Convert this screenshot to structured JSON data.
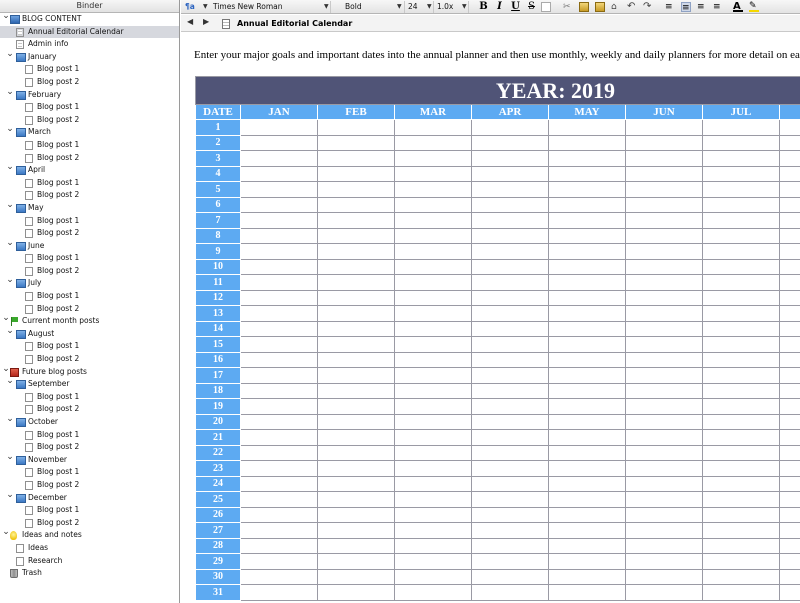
{
  "binder": {
    "title": "Binder",
    "items": [
      {
        "label": "BLOG CONTENT",
        "level": 0,
        "icon": "folder-root-icon",
        "chevron": true
      },
      {
        "label": "Annual Editorial Calendar",
        "level": 1,
        "icon": "document-text-icon",
        "selected": true
      },
      {
        "label": "Admin info",
        "level": 1,
        "icon": "document-text-icon"
      },
      {
        "label": "January",
        "level": 1,
        "icon": "folder-icon",
        "chevron": true
      },
      {
        "label": "Blog post 1",
        "level": 2,
        "icon": "document-icon"
      },
      {
        "label": "Blog post 2",
        "level": 2,
        "icon": "document-icon"
      },
      {
        "label": "February",
        "level": 1,
        "icon": "folder-icon",
        "chevron": true
      },
      {
        "label": "Blog post 1",
        "level": 2,
        "icon": "document-icon"
      },
      {
        "label": "Blog post 2",
        "level": 2,
        "icon": "document-icon"
      },
      {
        "label": "March",
        "level": 1,
        "icon": "folder-icon",
        "chevron": true
      },
      {
        "label": "Blog post 1",
        "level": 2,
        "icon": "document-icon"
      },
      {
        "label": "Blog post 2",
        "level": 2,
        "icon": "document-icon"
      },
      {
        "label": "April",
        "level": 1,
        "icon": "folder-icon",
        "chevron": true
      },
      {
        "label": "Blog post 1",
        "level": 2,
        "icon": "document-icon"
      },
      {
        "label": "Blog post 2",
        "level": 2,
        "icon": "document-icon"
      },
      {
        "label": "May",
        "level": 1,
        "icon": "folder-icon",
        "chevron": true
      },
      {
        "label": "Blog post 1",
        "level": 2,
        "icon": "document-icon"
      },
      {
        "label": "Blog post 2",
        "level": 2,
        "icon": "document-icon"
      },
      {
        "label": "June",
        "level": 1,
        "icon": "folder-icon",
        "chevron": true
      },
      {
        "label": "Blog post 1",
        "level": 2,
        "icon": "document-icon"
      },
      {
        "label": "Blog post 2",
        "level": 2,
        "icon": "document-icon"
      },
      {
        "label": "July",
        "level": 1,
        "icon": "folder-icon",
        "chevron": true
      },
      {
        "label": "Blog post 1",
        "level": 2,
        "icon": "document-icon"
      },
      {
        "label": "Blog post 2",
        "level": 2,
        "icon": "document-icon"
      },
      {
        "label": "Current month posts",
        "level": 0,
        "icon": "flag-icon",
        "chevron": true
      },
      {
        "label": "August",
        "level": 1,
        "icon": "folder-icon",
        "chevron": true
      },
      {
        "label": "Blog post 1",
        "level": 2,
        "icon": "document-icon"
      },
      {
        "label": "Blog post 2",
        "level": 2,
        "icon": "document-icon"
      },
      {
        "label": "Future blog posts",
        "level": 0,
        "icon": "red-book-icon",
        "chevron": true
      },
      {
        "label": "September",
        "level": 1,
        "icon": "folder-icon",
        "chevron": true
      },
      {
        "label": "Blog post 1",
        "level": 2,
        "icon": "document-icon"
      },
      {
        "label": "Blog post 2",
        "level": 2,
        "icon": "document-icon"
      },
      {
        "label": "October",
        "level": 1,
        "icon": "folder-icon",
        "chevron": true
      },
      {
        "label": "Blog post 1",
        "level": 2,
        "icon": "document-icon"
      },
      {
        "label": "Blog post 2",
        "level": 2,
        "icon": "document-icon"
      },
      {
        "label": "November",
        "level": 1,
        "icon": "folder-icon",
        "chevron": true
      },
      {
        "label": "Blog post 1",
        "level": 2,
        "icon": "document-icon"
      },
      {
        "label": "Blog post 2",
        "level": 2,
        "icon": "document-icon"
      },
      {
        "label": "December",
        "level": 1,
        "icon": "folder-icon",
        "chevron": true
      },
      {
        "label": "Blog post 1",
        "level": 2,
        "icon": "document-icon"
      },
      {
        "label": "Blog post 2",
        "level": 2,
        "icon": "document-icon"
      },
      {
        "label": "Ideas and notes",
        "level": 0,
        "icon": "lightbulb-icon",
        "chevron": true
      },
      {
        "label": "Ideas",
        "level": 1,
        "icon": "document-icon"
      },
      {
        "label": "Research",
        "level": 1,
        "icon": "document-icon"
      },
      {
        "label": "Trash",
        "level": 0,
        "icon": "trash-icon"
      }
    ]
  },
  "format_bar": {
    "font_family": "Times New Roman",
    "font_style": "Bold",
    "font_size": "24",
    "line_spacing": "1.0x",
    "buttons": [
      "bold",
      "italic",
      "underline",
      "strikethrough"
    ]
  },
  "header_bar": {
    "title": "Annual Editorial Calendar"
  },
  "editor": {
    "intro": "Enter your major goals and important dates into the annual planner and then use monthly, weekly and daily planners for more detail on each task"
  },
  "calendar": {
    "year_label": "YEAR: 2019",
    "date_header": "DATE",
    "months": [
      "JAN",
      "FEB",
      "MAR",
      "APR",
      "MAY",
      "JUN",
      "JUL"
    ],
    "days": [
      "1",
      "2",
      "3",
      "4",
      "5",
      "6",
      "7",
      "8",
      "9",
      "10",
      "11",
      "12",
      "13",
      "14",
      "15",
      "16",
      "17",
      "18",
      "19",
      "20",
      "21",
      "22",
      "23",
      "24",
      "25",
      "26",
      "27",
      "28",
      "29",
      "30",
      "31"
    ]
  },
  "colors": {
    "year_band": "#505477",
    "header_blue": "#5daaf2",
    "selection": "#d6d8de"
  }
}
